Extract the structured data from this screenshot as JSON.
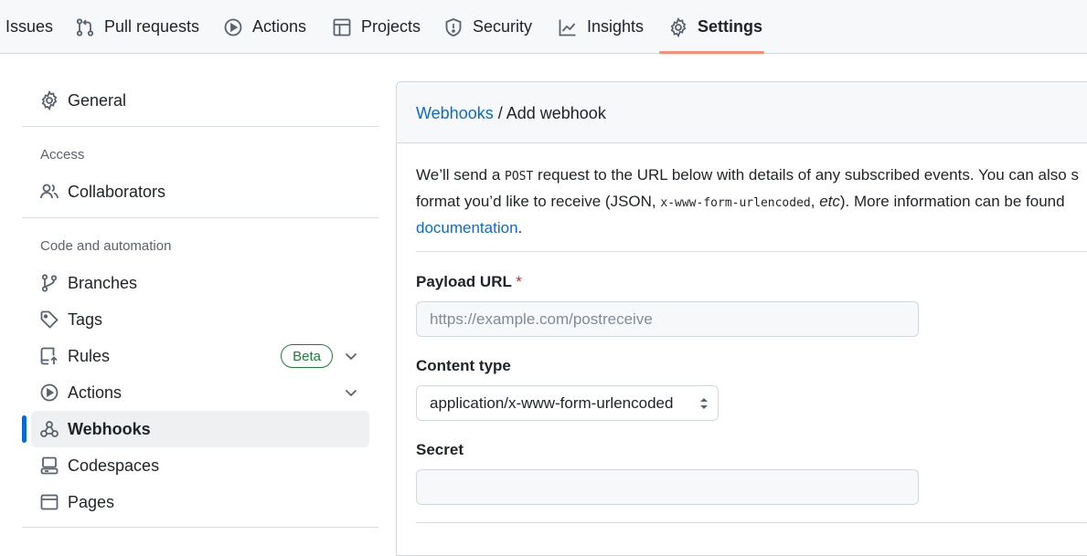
{
  "topnav": {
    "tabs": [
      {
        "label": "Issues",
        "icon": "issue-icon"
      },
      {
        "label": "Pull requests",
        "icon": "pull-request-icon"
      },
      {
        "label": "Actions",
        "icon": "play-icon"
      },
      {
        "label": "Projects",
        "icon": "table-icon"
      },
      {
        "label": "Security",
        "icon": "shield-icon"
      },
      {
        "label": "Insights",
        "icon": "graph-icon"
      },
      {
        "label": "Settings",
        "icon": "gear-icon",
        "selected": true
      }
    ],
    "underline_color": "#fd8c73"
  },
  "sidebar": {
    "general": "General",
    "access_heading": "Access",
    "collaborators": "Collaborators",
    "code_heading": "Code and automation",
    "branches": "Branches",
    "tags": "Tags",
    "rules": "Rules",
    "rules_badge": "Beta",
    "actions": "Actions",
    "webhooks": "Webhooks",
    "codespaces": "Codespaces",
    "pages": "Pages",
    "selected": "Webhooks",
    "accent": "#0969da"
  },
  "main": {
    "breadcrumb_parent": "Webhooks",
    "breadcrumb_sep": " / ",
    "breadcrumb_current": "Add webhook",
    "desc_line1_a": "We’ll send a ",
    "desc_post": "POST",
    "desc_line1_b": " request to the URL below with details of any subscribed events. You can also s",
    "desc_line2_a": "format you’d like to receive (JSON, ",
    "desc_code": "x-www-form-urlencoded",
    "desc_line2_b": ", ",
    "desc_etc": "etc",
    "desc_line2_c": "). More information can be found",
    "desc_link": "documentation",
    "desc_end": ".",
    "payload_label": "Payload URL",
    "required_mark": "*",
    "payload_placeholder": "https://example.com/postreceive",
    "content_type_label": "Content type",
    "content_type_value": "application/x-www-form-urlencoded",
    "secret_label": "Secret",
    "secret_value": ""
  }
}
